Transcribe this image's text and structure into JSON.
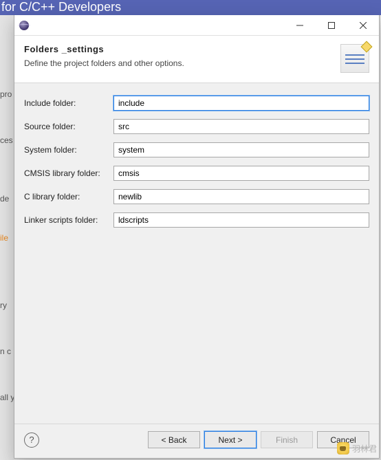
{
  "background": {
    "title_fragment": "for C/C++ Developers",
    "left_fragments": [
      "pro",
      "ces",
      "de",
      "ile",
      "ry",
      "n c",
      "all y"
    ]
  },
  "dialog": {
    "header": {
      "title": "Folders _settings",
      "subtitle": "Define the project folders and other options."
    },
    "fields": {
      "include": {
        "label": "Include folder:",
        "value": "include"
      },
      "source": {
        "label": "Source folder:",
        "value": "src"
      },
      "system": {
        "label": "System folder:",
        "value": "system"
      },
      "cmsis": {
        "label": "CMSIS library folder:",
        "value": "cmsis"
      },
      "clib": {
        "label": "C library folder:",
        "value": "newlib"
      },
      "linker": {
        "label": "Linker scripts folder:",
        "value": "ldscripts"
      }
    },
    "buttons": {
      "back": "< Back",
      "next": "Next >",
      "finish": "Finish",
      "cancel": "Cancel"
    }
  },
  "watermark": {
    "text": "羽林君"
  },
  "colors": {
    "accent": "#2a7de1"
  }
}
